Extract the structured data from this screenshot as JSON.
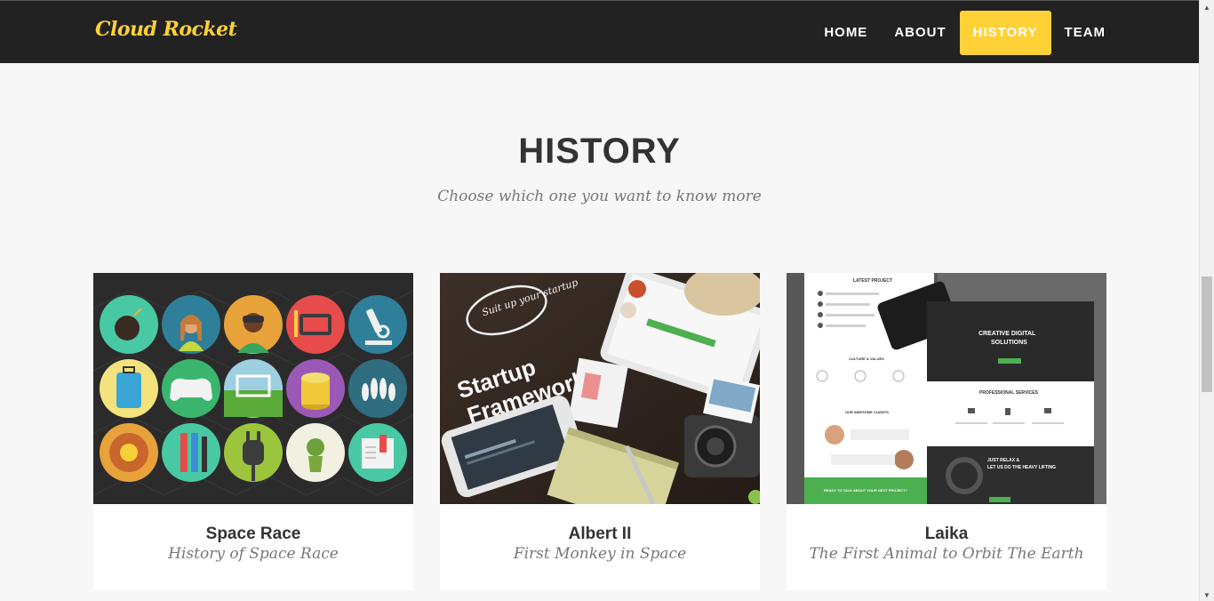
{
  "navbar": {
    "brand": "Cloud Rocket",
    "items": [
      {
        "label": "HOME",
        "active": false
      },
      {
        "label": "ABOUT",
        "active": false
      },
      {
        "label": "HISTORY",
        "active": true
      },
      {
        "label": "TEAM",
        "active": false
      }
    ]
  },
  "section": {
    "title": "HISTORY",
    "subtitle": "Choose which one you want to know more"
  },
  "cards": [
    {
      "title": "Space Race",
      "subtitle": "History of Space Race"
    },
    {
      "title": "Albert II",
      "subtitle": "First Monkey in Space"
    },
    {
      "title": "Laika",
      "subtitle": "The First Animal to Orbit The Earth"
    }
  ],
  "card2_image_text": {
    "badge": "Suit up your startup",
    "headline": "Startup Framework"
  },
  "card3_image_text": {
    "latest": "LATEST PROJECT",
    "hero": "CREATIVE DIGITAL SOLUTIONS",
    "culture": "CULTURE & VALUES",
    "services": "PROFESSIONAL SERVICES",
    "clients": "OUR AWESOME CLIENTS",
    "relax": "JUST RELAX & LET US DO THE HEAVY LIFTING",
    "cta": "READY TO TALK ABOUT YOUR NEXT PROJECT?"
  },
  "colors": {
    "accent": "#fed136",
    "navbar_bg": "#222222",
    "page_bg": "#f7f7f7"
  }
}
